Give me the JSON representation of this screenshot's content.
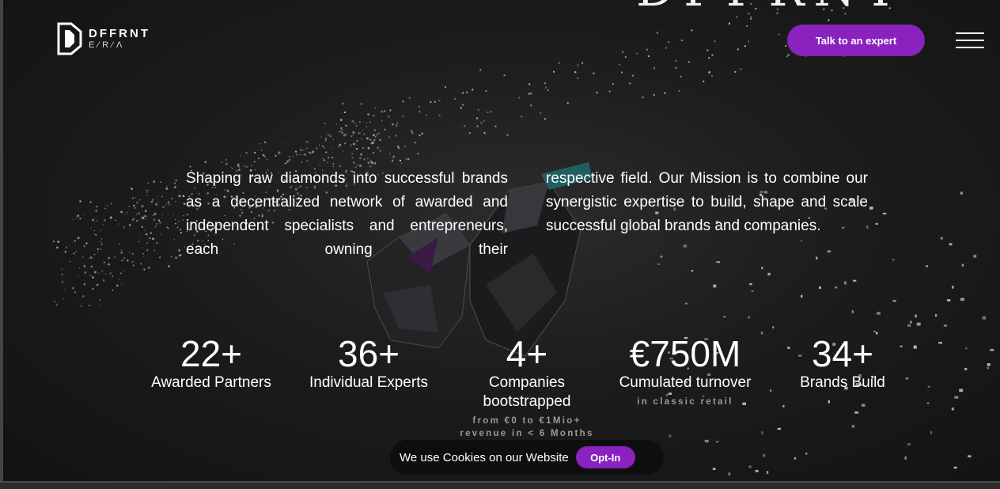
{
  "brand": {
    "name": "DFFRNT",
    "sub": "E⁄R⁄Λ",
    "watermark": "DFFRNT"
  },
  "header": {
    "cta_label": "Talk to an expert"
  },
  "mission": {
    "left": "Shaping raw diamonds into successful brands as a decentralized network of awarded and independent specialists and entrepreneurs, each owning their",
    "right": "respective field. Our Mission is to combine our synergistic expertise to build, shape and scale successful global brands and companies."
  },
  "stats": [
    {
      "value": "22+",
      "label": "Awarded Partners"
    },
    {
      "value": "36+",
      "label": "Individual Experts"
    },
    {
      "value": "4+",
      "label": "Companies bootstrapped",
      "note": "from €0 to €1Mio+ revenue in < 6 Months"
    },
    {
      "value": "€750M",
      "label": "Cumulated turnover",
      "note": "in classic retail"
    },
    {
      "value": "34+",
      "label": "Brands Build"
    }
  ],
  "cookie": {
    "text": "We use Cookies on our Website",
    "button": "Opt-In"
  },
  "colors": {
    "accent": "#8a22c0",
    "background": "#1a1a1a",
    "text": "#ffffff"
  },
  "icons": {
    "logo": "dffrnt-logo-icon",
    "menu": "hamburger-menu-icon"
  }
}
